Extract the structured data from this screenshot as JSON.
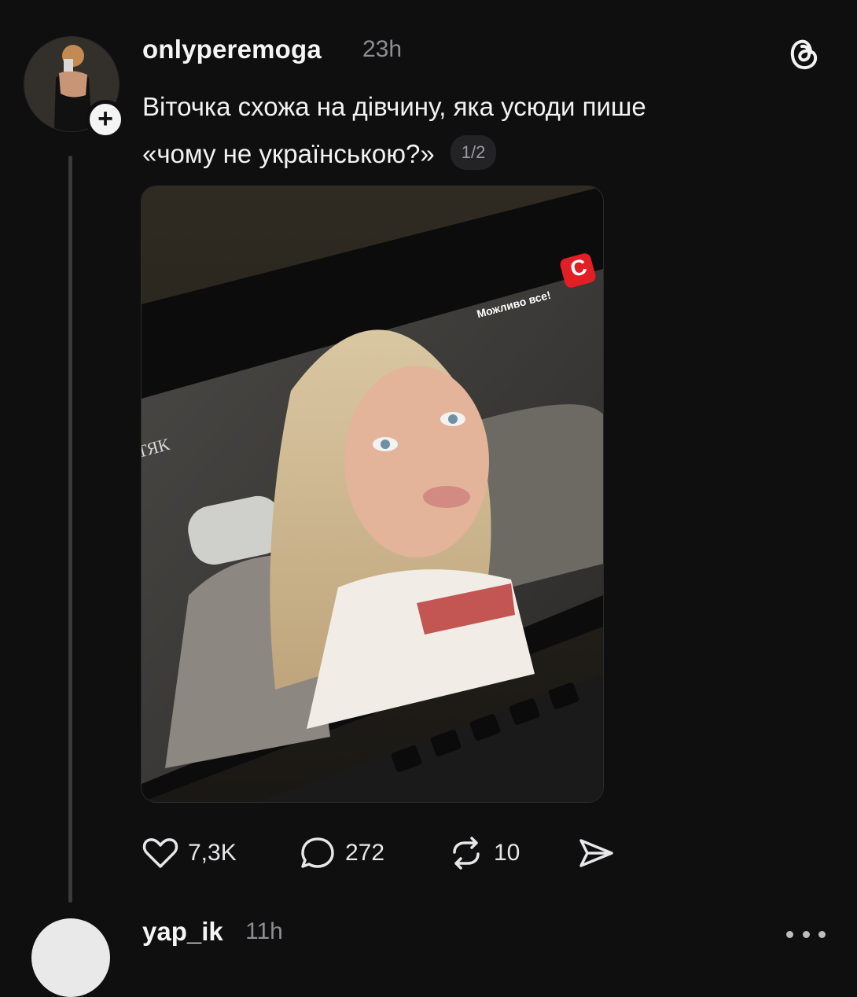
{
  "post": {
    "username": "onlyperemoga",
    "time": "23h",
    "text_line1": "Віточка схожа на дівчину, яка усюди пише",
    "text_line2": "«чому не українською?»",
    "page_indicator": "1/2",
    "media": {
      "channel_logo": "C",
      "overlay_caption": "Можливо все!",
      "side_label": "ТЯК"
    },
    "actions": {
      "likes": "7,3K",
      "comments": "272",
      "reposts": "10"
    }
  },
  "next_post": {
    "username": "yap_ik",
    "time": "11h"
  },
  "icons": {
    "threads": "threads-logo-icon",
    "like": "heart-icon",
    "comment": "comment-bubble-icon",
    "repost": "repost-icon",
    "share": "send-icon",
    "more": "more-dots-icon"
  }
}
